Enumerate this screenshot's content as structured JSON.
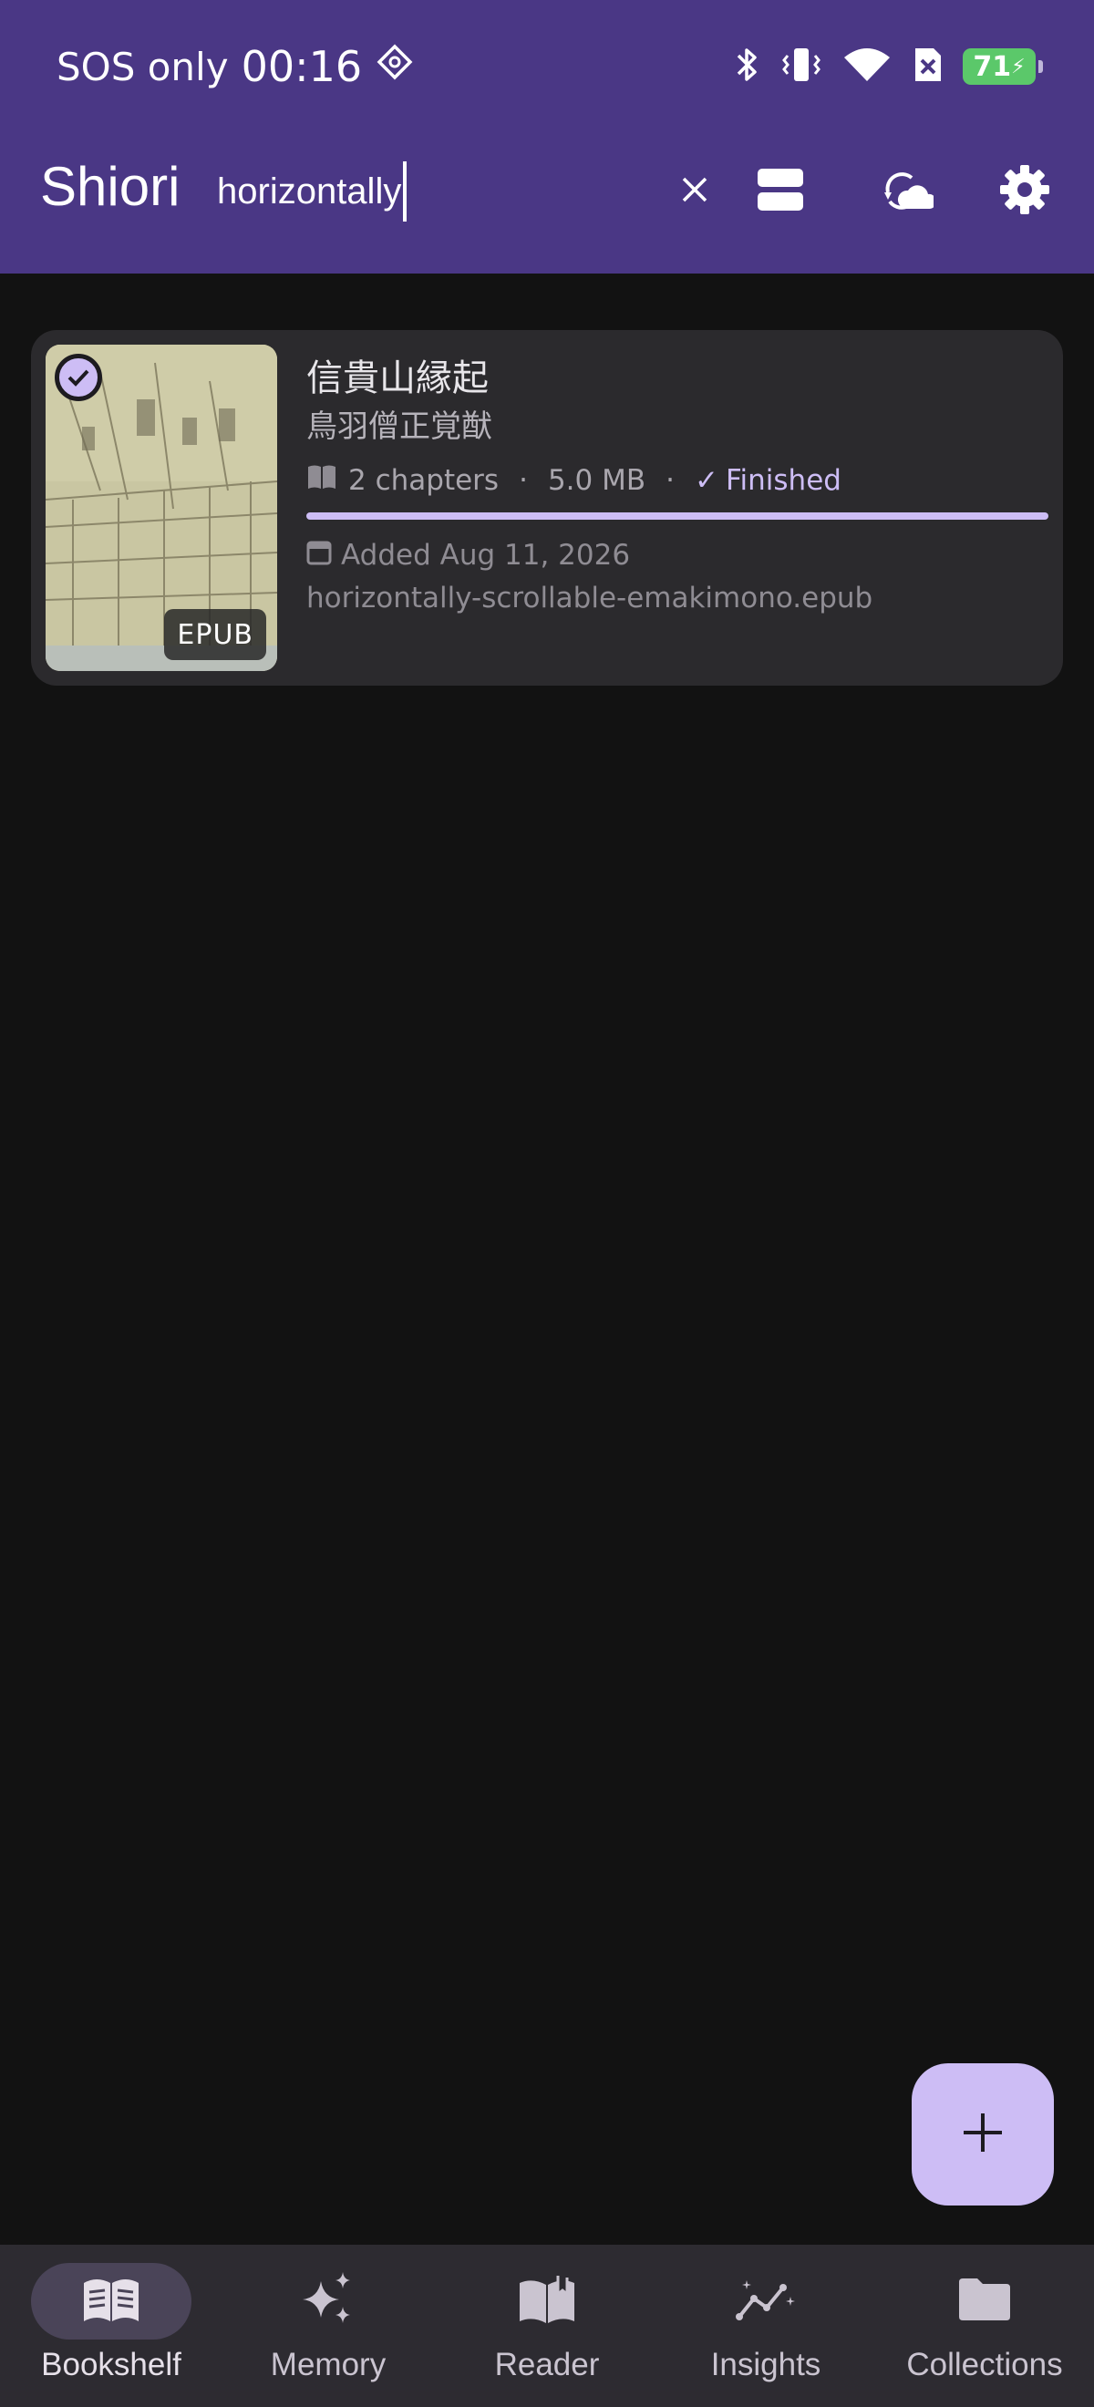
{
  "status_bar": {
    "carrier": "SOS only",
    "time": "00:16",
    "battery": "71"
  },
  "app_bar": {
    "title": "Shiori",
    "search_value": "horizontally",
    "icons": [
      "close-icon",
      "view-toggle-icon",
      "sync-cloud-icon",
      "settings-icon"
    ]
  },
  "books": [
    {
      "title": "信貴山縁起",
      "author": "鳥羽僧正覚猷",
      "chapters": "2 chapters",
      "size": "5.0 MB",
      "status": "Finished",
      "status_icon": "✓",
      "progress": 1.0,
      "added": "Added Aug 11, 2026",
      "filename": "horizontally-scrollable-emakimono.epub",
      "format": "EPUB",
      "selected": true
    }
  ],
  "fab": {
    "icon": "plus-icon"
  },
  "bottom_nav": [
    {
      "label": "Bookshelf",
      "icon": "book-open-icon",
      "active": true
    },
    {
      "label": "Memory",
      "icon": "sparkles-icon",
      "active": false
    },
    {
      "label": "Reader",
      "icon": "reader-book-icon",
      "active": false
    },
    {
      "label": "Insights",
      "icon": "insights-chart-icon",
      "active": false
    },
    {
      "label": "Collections",
      "icon": "folder-icon",
      "active": false
    }
  ],
  "colors": {
    "app_bar": "#4a3785",
    "background": "#121212",
    "card": "#2b2a2d",
    "accent": "#cdbdf5",
    "nav_bar": "#2d2b31"
  }
}
